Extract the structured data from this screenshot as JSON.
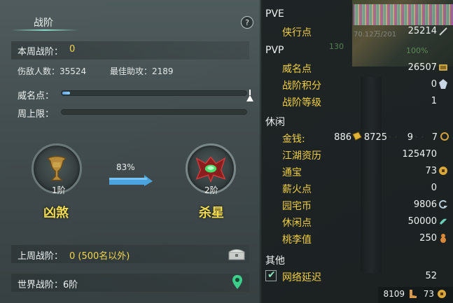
{
  "left": {
    "title": "战阶",
    "help": "?",
    "weekly_rank_label": "本周战阶：",
    "weekly_rank_value": "0",
    "kills": "伤敌人数：35524",
    "best_assist": "最佳助攻：2189",
    "prestige_label": "威名点：",
    "prestige_progress": 0.04,
    "weekly_cap_label": "周上限：",
    "weekly_cap_progress": 0,
    "current_rank": {
      "level": "1阶",
      "name": "凶煞"
    },
    "next_rank": {
      "level": "2阶",
      "name": "杀星"
    },
    "progress_pct": "83%",
    "last_week_label": "上周战阶：",
    "last_week_value": "0 (500名以外)",
    "world_rank": "世界战阶：6阶"
  },
  "right": {
    "pve": {
      "title": "PVE",
      "chivalry_label": "侠行点",
      "chivalry_value": "25214"
    },
    "pvp": {
      "title": "PVP",
      "items": [
        {
          "label": "威名点",
          "value": "26507",
          "icon": "prestige-icon"
        },
        {
          "label": "战阶积分",
          "value": "0",
          "icon": "rank-points-icon"
        },
        {
          "label": "战阶等级",
          "value": "1",
          "icon": ""
        }
      ]
    },
    "leisure": {
      "title": "休闲",
      "money_label": "金钱:",
      "money_gold": "886",
      "money_silver_ingot": "8725",
      "money_silver": "9",
      "money_copper": "7",
      "items": [
        {
          "label": "江湖资历",
          "value": "125470",
          "icon": ""
        },
        {
          "label": "通宝",
          "value": "73",
          "icon": "coin-icon"
        },
        {
          "label": "薪火点",
          "value": "0",
          "icon": ""
        },
        {
          "label": "园宅币",
          "value": "9806",
          "icon": "garden-coin-icon"
        },
        {
          "label": "休闲点",
          "value": "50000",
          "icon": "leisure-icon"
        },
        {
          "label": "桃李值",
          "value": "250",
          "icon": "gourd-icon"
        }
      ]
    },
    "other": {
      "title": "其他",
      "latency_label": "网络延迟",
      "latency_value": "52"
    },
    "bottom": {
      "value1": "8109",
      "value2": "73"
    },
    "bg_numbers": {
      "n1": "130",
      "n2": "100%",
      "n3": "70.12万/201"
    }
  },
  "colors": {
    "accent": "#f3d64d",
    "label_gold": "#f0cf45",
    "bar_blue": "#5aa6e8"
  }
}
